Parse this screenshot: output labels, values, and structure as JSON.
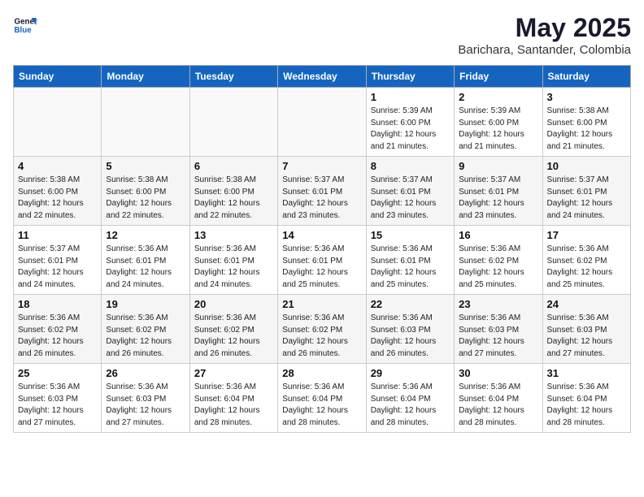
{
  "header": {
    "logo_general": "General",
    "logo_blue": "Blue",
    "month_year": "May 2025",
    "location": "Barichara, Santander, Colombia"
  },
  "days_of_week": [
    "Sunday",
    "Monday",
    "Tuesday",
    "Wednesday",
    "Thursday",
    "Friday",
    "Saturday"
  ],
  "weeks": [
    [
      {
        "day": "",
        "info": ""
      },
      {
        "day": "",
        "info": ""
      },
      {
        "day": "",
        "info": ""
      },
      {
        "day": "",
        "info": ""
      },
      {
        "day": "1",
        "info": "Sunrise: 5:39 AM\nSunset: 6:00 PM\nDaylight: 12 hours\nand 21 minutes."
      },
      {
        "day": "2",
        "info": "Sunrise: 5:39 AM\nSunset: 6:00 PM\nDaylight: 12 hours\nand 21 minutes."
      },
      {
        "day": "3",
        "info": "Sunrise: 5:38 AM\nSunset: 6:00 PM\nDaylight: 12 hours\nand 21 minutes."
      }
    ],
    [
      {
        "day": "4",
        "info": "Sunrise: 5:38 AM\nSunset: 6:00 PM\nDaylight: 12 hours\nand 22 minutes."
      },
      {
        "day": "5",
        "info": "Sunrise: 5:38 AM\nSunset: 6:00 PM\nDaylight: 12 hours\nand 22 minutes."
      },
      {
        "day": "6",
        "info": "Sunrise: 5:38 AM\nSunset: 6:00 PM\nDaylight: 12 hours\nand 22 minutes."
      },
      {
        "day": "7",
        "info": "Sunrise: 5:37 AM\nSunset: 6:01 PM\nDaylight: 12 hours\nand 23 minutes."
      },
      {
        "day": "8",
        "info": "Sunrise: 5:37 AM\nSunset: 6:01 PM\nDaylight: 12 hours\nand 23 minutes."
      },
      {
        "day": "9",
        "info": "Sunrise: 5:37 AM\nSunset: 6:01 PM\nDaylight: 12 hours\nand 23 minutes."
      },
      {
        "day": "10",
        "info": "Sunrise: 5:37 AM\nSunset: 6:01 PM\nDaylight: 12 hours\nand 24 minutes."
      }
    ],
    [
      {
        "day": "11",
        "info": "Sunrise: 5:37 AM\nSunset: 6:01 PM\nDaylight: 12 hours\nand 24 minutes."
      },
      {
        "day": "12",
        "info": "Sunrise: 5:36 AM\nSunset: 6:01 PM\nDaylight: 12 hours\nand 24 minutes."
      },
      {
        "day": "13",
        "info": "Sunrise: 5:36 AM\nSunset: 6:01 PM\nDaylight: 12 hours\nand 24 minutes."
      },
      {
        "day": "14",
        "info": "Sunrise: 5:36 AM\nSunset: 6:01 PM\nDaylight: 12 hours\nand 25 minutes."
      },
      {
        "day": "15",
        "info": "Sunrise: 5:36 AM\nSunset: 6:01 PM\nDaylight: 12 hours\nand 25 minutes."
      },
      {
        "day": "16",
        "info": "Sunrise: 5:36 AM\nSunset: 6:02 PM\nDaylight: 12 hours\nand 25 minutes."
      },
      {
        "day": "17",
        "info": "Sunrise: 5:36 AM\nSunset: 6:02 PM\nDaylight: 12 hours\nand 25 minutes."
      }
    ],
    [
      {
        "day": "18",
        "info": "Sunrise: 5:36 AM\nSunset: 6:02 PM\nDaylight: 12 hours\nand 26 minutes."
      },
      {
        "day": "19",
        "info": "Sunrise: 5:36 AM\nSunset: 6:02 PM\nDaylight: 12 hours\nand 26 minutes."
      },
      {
        "day": "20",
        "info": "Sunrise: 5:36 AM\nSunset: 6:02 PM\nDaylight: 12 hours\nand 26 minutes."
      },
      {
        "day": "21",
        "info": "Sunrise: 5:36 AM\nSunset: 6:02 PM\nDaylight: 12 hours\nand 26 minutes."
      },
      {
        "day": "22",
        "info": "Sunrise: 5:36 AM\nSunset: 6:03 PM\nDaylight: 12 hours\nand 26 minutes."
      },
      {
        "day": "23",
        "info": "Sunrise: 5:36 AM\nSunset: 6:03 PM\nDaylight: 12 hours\nand 27 minutes."
      },
      {
        "day": "24",
        "info": "Sunrise: 5:36 AM\nSunset: 6:03 PM\nDaylight: 12 hours\nand 27 minutes."
      }
    ],
    [
      {
        "day": "25",
        "info": "Sunrise: 5:36 AM\nSunset: 6:03 PM\nDaylight: 12 hours\nand 27 minutes."
      },
      {
        "day": "26",
        "info": "Sunrise: 5:36 AM\nSunset: 6:03 PM\nDaylight: 12 hours\nand 27 minutes."
      },
      {
        "day": "27",
        "info": "Sunrise: 5:36 AM\nSunset: 6:04 PM\nDaylight: 12 hours\nand 28 minutes."
      },
      {
        "day": "28",
        "info": "Sunrise: 5:36 AM\nSunset: 6:04 PM\nDaylight: 12 hours\nand 28 minutes."
      },
      {
        "day": "29",
        "info": "Sunrise: 5:36 AM\nSunset: 6:04 PM\nDaylight: 12 hours\nand 28 minutes."
      },
      {
        "day": "30",
        "info": "Sunrise: 5:36 AM\nSunset: 6:04 PM\nDaylight: 12 hours\nand 28 minutes."
      },
      {
        "day": "31",
        "info": "Sunrise: 5:36 AM\nSunset: 6:04 PM\nDaylight: 12 hours\nand 28 minutes."
      }
    ]
  ]
}
